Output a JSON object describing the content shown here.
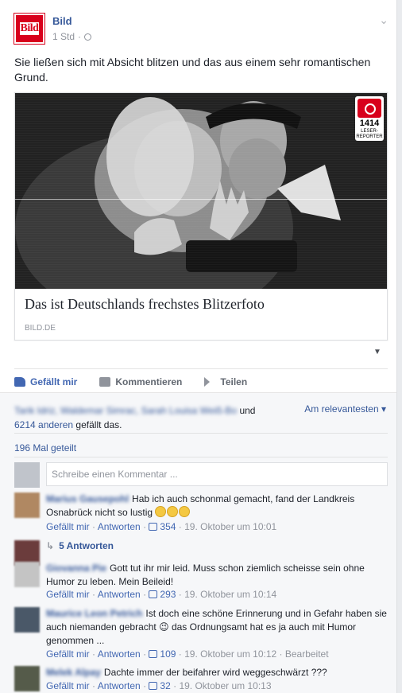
{
  "page": {
    "name": "Bild",
    "logo_text": "Bild",
    "time": "1 Std"
  },
  "post": {
    "text": "Sie ließen sich mit Absicht blitzen und das aus einem sehr romantischen Grund.",
    "card": {
      "title": "Das ist Deutschlands frechstes Blitzerfoto",
      "domain": "BILD.DE",
      "badge_number": "1414",
      "badge_label": "LESER-REPORTER"
    }
  },
  "actions": {
    "like": "Gefällt mir",
    "comment": "Kommentieren",
    "share": "Teilen"
  },
  "likes": {
    "names": "Tarik Idriz, Waldemar Simrac, Sarah Louisa Weiß-Bo",
    "and": "und",
    "others": "6214 anderen",
    "suffix": "gefällt das.",
    "sort": "Am relevantesten"
  },
  "shares": "196 Mal geteilt",
  "comment_box": {
    "placeholder": "Schreibe einen Kommentar ..."
  },
  "comments": [
    {
      "name": "Marius Gausepohl",
      "text": "Hab ich auch schonmal gemacht, fand der Landkreis Osnabrück nicht so lustig",
      "like": "Gefällt mir",
      "reply": "Antworten",
      "count": "354",
      "date": "19. Oktober um 10:01",
      "replies": "5 Antworten"
    },
    {
      "name": "Giovanna Pie",
      "text": "Gott tut ihr mir leid. Muss schon ziemlich scheisse sein ohne Humor zu leben. Mein Beileid!",
      "like": "Gefällt mir",
      "reply": "Antworten",
      "count": "293",
      "date": "19. Oktober um 10:14"
    },
    {
      "name": "Maurice Leon Petrich",
      "text": "Ist doch eine schöne Erinnerung und in Gefahr haben sie auch niemanden gebracht 😉 das Ordnungsamt hat es ja auch mit Humor genommen ...",
      "like": "Gefällt mir",
      "reply": "Antworten",
      "count": "109",
      "date": "19. Oktober um 10:12",
      "edited": "Bearbeitet"
    },
    {
      "name": "Melek Alpay",
      "text": "Dachte immer der beifahrer wird weggeschwärzt ???",
      "like": "Gefällt mir",
      "reply": "Antworten",
      "count": "32",
      "date": "19. Oktober um 10:13"
    }
  ]
}
